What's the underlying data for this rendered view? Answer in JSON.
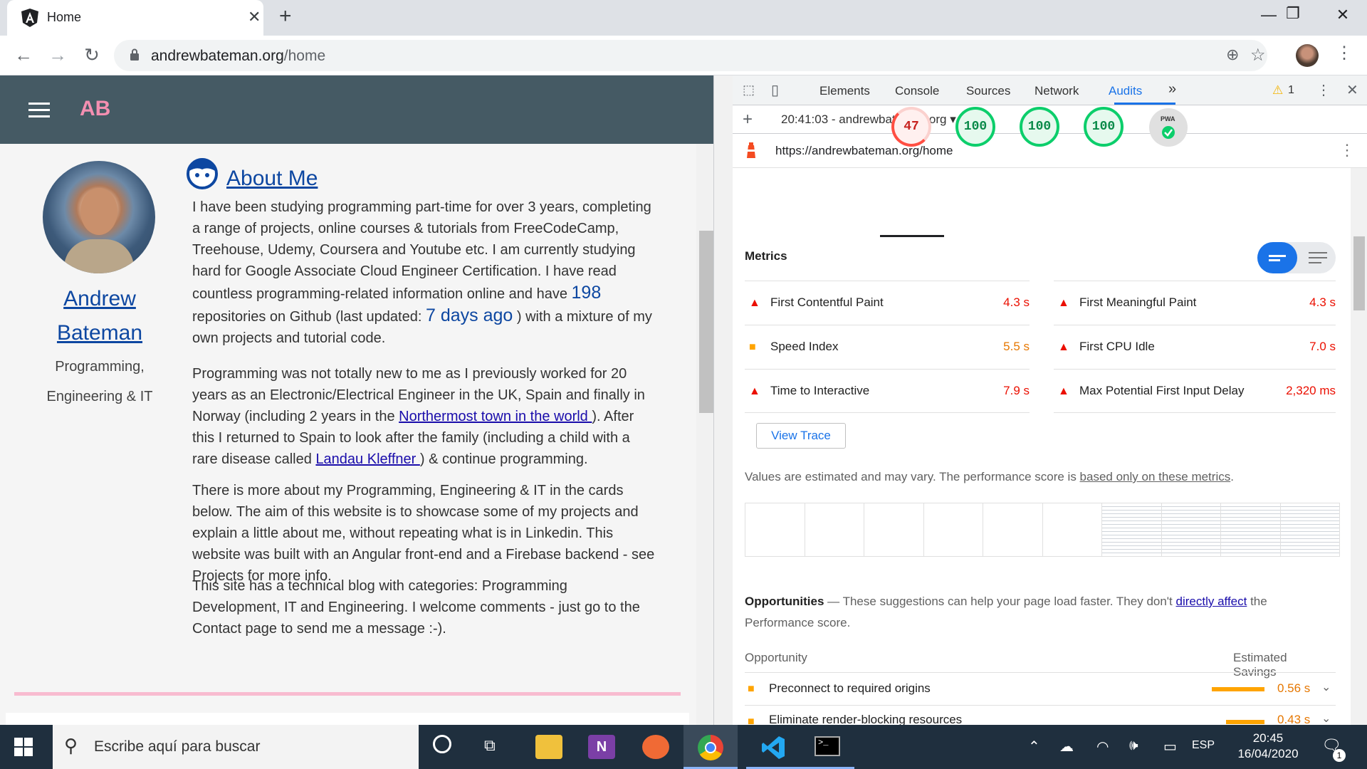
{
  "browser": {
    "tab_title": "Home",
    "tab_close": "✕",
    "new_tab": "+",
    "url_host": "andrewbateman.org",
    "url_path": "/home"
  },
  "page": {
    "brand": "AB",
    "profile": {
      "name_line1": "Andrew",
      "name_line2": "Bateman",
      "role_line1": "Programming,",
      "role_line2": "Engineering & IT"
    },
    "about_title": "About Me",
    "para1": {
      "a": "I have been studying programming part-time for over 3 years, completing a range of projects, online courses & tutorials from FreeCodeCamp, Treehouse, Udemy, Coursera and Youtube etc. I am currently studying hard for Google Associate Cloud Engineer Certification. I have read countless programming-related information online and have ",
      "repos": "198",
      "b": " repositories on Github (last updated: ",
      "updated": "7 days ago",
      "c": " ) with a mixture of my own projects and tutorial code."
    },
    "para2": {
      "a": "Programming was not totally new to me as I previously worked for 20 years as an Electronic/Electrical Engineer in the UK, Spain and finally in Norway (including 2 years in the ",
      "link1": "Northermost town in the world ",
      "b": "). After this I returned to Spain to look after the family (including a child with a rare disease called ",
      "link2": "Landau Kleffner ",
      "c": ") & continue programming."
    },
    "para3": "There is more about my Programming, Engineering & IT in the cards below. The aim of this website is to showcase some of my projects and explain a little about me, without repeating what is in Linkedin. This website was built with an Angular front-end and a Firebase backend - see Projects for more info.",
    "para4": "This site has a technical blog with categories: Programming Development, IT and Engineering. I welcome comments - just go to the Contact page to send me a message :-)."
  },
  "devtools": {
    "tabs": [
      "Elements",
      "Console",
      "Sources",
      "Network",
      "Audits"
    ],
    "active_tab": "Audits",
    "more_tabs": "»",
    "warnings": "1",
    "report_selector": "20:41:03 - andrewbateman.org ▾",
    "audited_url": "https://andrewbateman.org/home",
    "scores": [
      "47",
      "100",
      "100",
      "100"
    ],
    "pwa_label": "PWA",
    "metrics_title": "Metrics",
    "metrics": [
      {
        "label": "First Contentful Paint",
        "value": "4.3 s",
        "status": "fail"
      },
      {
        "label": "First Meaningful Paint",
        "value": "4.3 s",
        "status": "fail"
      },
      {
        "label": "Speed Index",
        "value": "5.5 s",
        "status": "average"
      },
      {
        "label": "First CPU Idle",
        "value": "7.0 s",
        "status": "fail"
      },
      {
        "label": "Time to Interactive",
        "value": "7.9 s",
        "status": "fail"
      },
      {
        "label": "Max Potential First Input Delay",
        "value": "2,320 ms",
        "status": "fail"
      }
    ],
    "view_trace": "View Trace",
    "disclaimer_text": "Values are estimated and may vary. The performance score is ",
    "disclaimer_link": "based only on these metrics",
    "disclaimer_end": ".",
    "opp_title": "Opportunities",
    "opp_desc_a": " — These suggestions can help your page load faster. They don't ",
    "opp_desc_link": "directly affect",
    "opp_desc_b": " the Performance score.",
    "opp_col_left": "Opportunity",
    "opp_col_right": "Estimated Savings",
    "opportunities": [
      {
        "label": "Preconnect to required origins",
        "value": "0.56 s"
      },
      {
        "label": "Eliminate render-blocking resources",
        "value": "0.43 s"
      }
    ]
  },
  "taskbar": {
    "search_placeholder": "Escribe aquí para buscar",
    "lang": "ESP",
    "time": "20:45",
    "date": "16/04/2020",
    "notifications": "1"
  },
  "colors": {
    "appbar": "#455a64",
    "brand": "#f48fb1",
    "link_blue": "#0d47a1",
    "score_pass": "#0cce6b",
    "score_fail": "#ff4e42",
    "score_average": "#ffa400"
  }
}
